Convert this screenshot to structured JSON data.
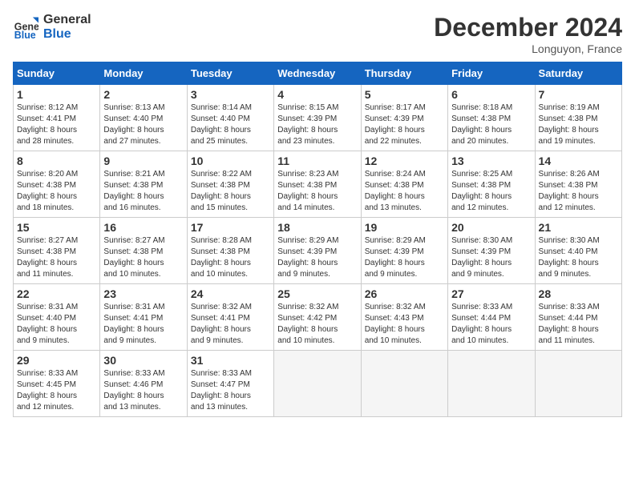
{
  "header": {
    "logo_line1": "General",
    "logo_line2": "Blue",
    "month": "December 2024",
    "location": "Longuyon, France"
  },
  "weekdays": [
    "Sunday",
    "Monday",
    "Tuesday",
    "Wednesday",
    "Thursday",
    "Friday",
    "Saturday"
  ],
  "weeks": [
    [
      {
        "day": "1",
        "lines": [
          "Sunrise: 8:12 AM",
          "Sunset: 4:41 PM",
          "Daylight: 8 hours",
          "and 28 minutes."
        ]
      },
      {
        "day": "2",
        "lines": [
          "Sunrise: 8:13 AM",
          "Sunset: 4:40 PM",
          "Daylight: 8 hours",
          "and 27 minutes."
        ]
      },
      {
        "day": "3",
        "lines": [
          "Sunrise: 8:14 AM",
          "Sunset: 4:40 PM",
          "Daylight: 8 hours",
          "and 25 minutes."
        ]
      },
      {
        "day": "4",
        "lines": [
          "Sunrise: 8:15 AM",
          "Sunset: 4:39 PM",
          "Daylight: 8 hours",
          "and 23 minutes."
        ]
      },
      {
        "day": "5",
        "lines": [
          "Sunrise: 8:17 AM",
          "Sunset: 4:39 PM",
          "Daylight: 8 hours",
          "and 22 minutes."
        ]
      },
      {
        "day": "6",
        "lines": [
          "Sunrise: 8:18 AM",
          "Sunset: 4:38 PM",
          "Daylight: 8 hours",
          "and 20 minutes."
        ]
      },
      {
        "day": "7",
        "lines": [
          "Sunrise: 8:19 AM",
          "Sunset: 4:38 PM",
          "Daylight: 8 hours",
          "and 19 minutes."
        ]
      }
    ],
    [
      {
        "day": "8",
        "lines": [
          "Sunrise: 8:20 AM",
          "Sunset: 4:38 PM",
          "Daylight: 8 hours",
          "and 18 minutes."
        ]
      },
      {
        "day": "9",
        "lines": [
          "Sunrise: 8:21 AM",
          "Sunset: 4:38 PM",
          "Daylight: 8 hours",
          "and 16 minutes."
        ]
      },
      {
        "day": "10",
        "lines": [
          "Sunrise: 8:22 AM",
          "Sunset: 4:38 PM",
          "Daylight: 8 hours",
          "and 15 minutes."
        ]
      },
      {
        "day": "11",
        "lines": [
          "Sunrise: 8:23 AM",
          "Sunset: 4:38 PM",
          "Daylight: 8 hours",
          "and 14 minutes."
        ]
      },
      {
        "day": "12",
        "lines": [
          "Sunrise: 8:24 AM",
          "Sunset: 4:38 PM",
          "Daylight: 8 hours",
          "and 13 minutes."
        ]
      },
      {
        "day": "13",
        "lines": [
          "Sunrise: 8:25 AM",
          "Sunset: 4:38 PM",
          "Daylight: 8 hours",
          "and 12 minutes."
        ]
      },
      {
        "day": "14",
        "lines": [
          "Sunrise: 8:26 AM",
          "Sunset: 4:38 PM",
          "Daylight: 8 hours",
          "and 12 minutes."
        ]
      }
    ],
    [
      {
        "day": "15",
        "lines": [
          "Sunrise: 8:27 AM",
          "Sunset: 4:38 PM",
          "Daylight: 8 hours",
          "and 11 minutes."
        ]
      },
      {
        "day": "16",
        "lines": [
          "Sunrise: 8:27 AM",
          "Sunset: 4:38 PM",
          "Daylight: 8 hours",
          "and 10 minutes."
        ]
      },
      {
        "day": "17",
        "lines": [
          "Sunrise: 8:28 AM",
          "Sunset: 4:38 PM",
          "Daylight: 8 hours",
          "and 10 minutes."
        ]
      },
      {
        "day": "18",
        "lines": [
          "Sunrise: 8:29 AM",
          "Sunset: 4:39 PM",
          "Daylight: 8 hours",
          "and 9 minutes."
        ]
      },
      {
        "day": "19",
        "lines": [
          "Sunrise: 8:29 AM",
          "Sunset: 4:39 PM",
          "Daylight: 8 hours",
          "and 9 minutes."
        ]
      },
      {
        "day": "20",
        "lines": [
          "Sunrise: 8:30 AM",
          "Sunset: 4:39 PM",
          "Daylight: 8 hours",
          "and 9 minutes."
        ]
      },
      {
        "day": "21",
        "lines": [
          "Sunrise: 8:30 AM",
          "Sunset: 4:40 PM",
          "Daylight: 8 hours",
          "and 9 minutes."
        ]
      }
    ],
    [
      {
        "day": "22",
        "lines": [
          "Sunrise: 8:31 AM",
          "Sunset: 4:40 PM",
          "Daylight: 8 hours",
          "and 9 minutes."
        ]
      },
      {
        "day": "23",
        "lines": [
          "Sunrise: 8:31 AM",
          "Sunset: 4:41 PM",
          "Daylight: 8 hours",
          "and 9 minutes."
        ]
      },
      {
        "day": "24",
        "lines": [
          "Sunrise: 8:32 AM",
          "Sunset: 4:41 PM",
          "Daylight: 8 hours",
          "and 9 minutes."
        ]
      },
      {
        "day": "25",
        "lines": [
          "Sunrise: 8:32 AM",
          "Sunset: 4:42 PM",
          "Daylight: 8 hours",
          "and 10 minutes."
        ]
      },
      {
        "day": "26",
        "lines": [
          "Sunrise: 8:32 AM",
          "Sunset: 4:43 PM",
          "Daylight: 8 hours",
          "and 10 minutes."
        ]
      },
      {
        "day": "27",
        "lines": [
          "Sunrise: 8:33 AM",
          "Sunset: 4:44 PM",
          "Daylight: 8 hours",
          "and 10 minutes."
        ]
      },
      {
        "day": "28",
        "lines": [
          "Sunrise: 8:33 AM",
          "Sunset: 4:44 PM",
          "Daylight: 8 hours",
          "and 11 minutes."
        ]
      }
    ],
    [
      {
        "day": "29",
        "lines": [
          "Sunrise: 8:33 AM",
          "Sunset: 4:45 PM",
          "Daylight: 8 hours",
          "and 12 minutes."
        ]
      },
      {
        "day": "30",
        "lines": [
          "Sunrise: 8:33 AM",
          "Sunset: 4:46 PM",
          "Daylight: 8 hours",
          "and 13 minutes."
        ]
      },
      {
        "day": "31",
        "lines": [
          "Sunrise: 8:33 AM",
          "Sunset: 4:47 PM",
          "Daylight: 8 hours",
          "and 13 minutes."
        ]
      },
      {
        "day": "",
        "lines": []
      },
      {
        "day": "",
        "lines": []
      },
      {
        "day": "",
        "lines": []
      },
      {
        "day": "",
        "lines": []
      }
    ]
  ]
}
